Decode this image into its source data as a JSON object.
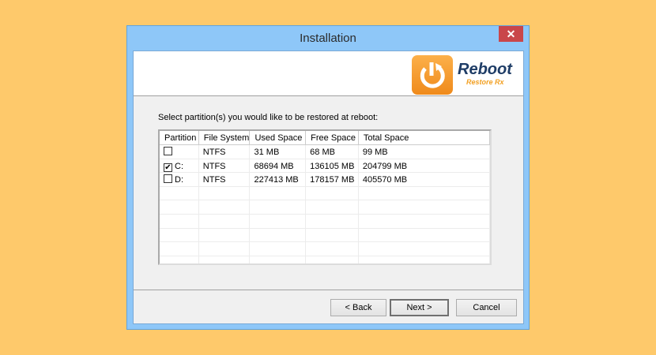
{
  "window": {
    "title": "Installation",
    "close_label": "✕"
  },
  "header": {
    "brand": "Reboot",
    "brand_sub": "Restore Rx",
    "accent": "#f39a2a"
  },
  "prompt": "Select partition(s) you would like to be restored at reboot:",
  "table": {
    "columns": [
      "Partition",
      "File System",
      "Used Space",
      "Free Space",
      "Total Space"
    ],
    "rows": [
      {
        "checked": false,
        "partition": "",
        "fs": "NTFS",
        "used": "31 MB",
        "free": "68 MB",
        "total": "99 MB"
      },
      {
        "checked": true,
        "partition": "C:",
        "fs": "NTFS",
        "used": "68694 MB",
        "free": "136105 MB",
        "total": "204799 MB"
      },
      {
        "checked": false,
        "partition": "D:",
        "fs": "NTFS",
        "used": "227413 MB",
        "free": "178157 MB",
        "total": "405570 MB"
      }
    ]
  },
  "buttons": {
    "back": "< Back",
    "next": "Next >",
    "cancel": "Cancel"
  }
}
